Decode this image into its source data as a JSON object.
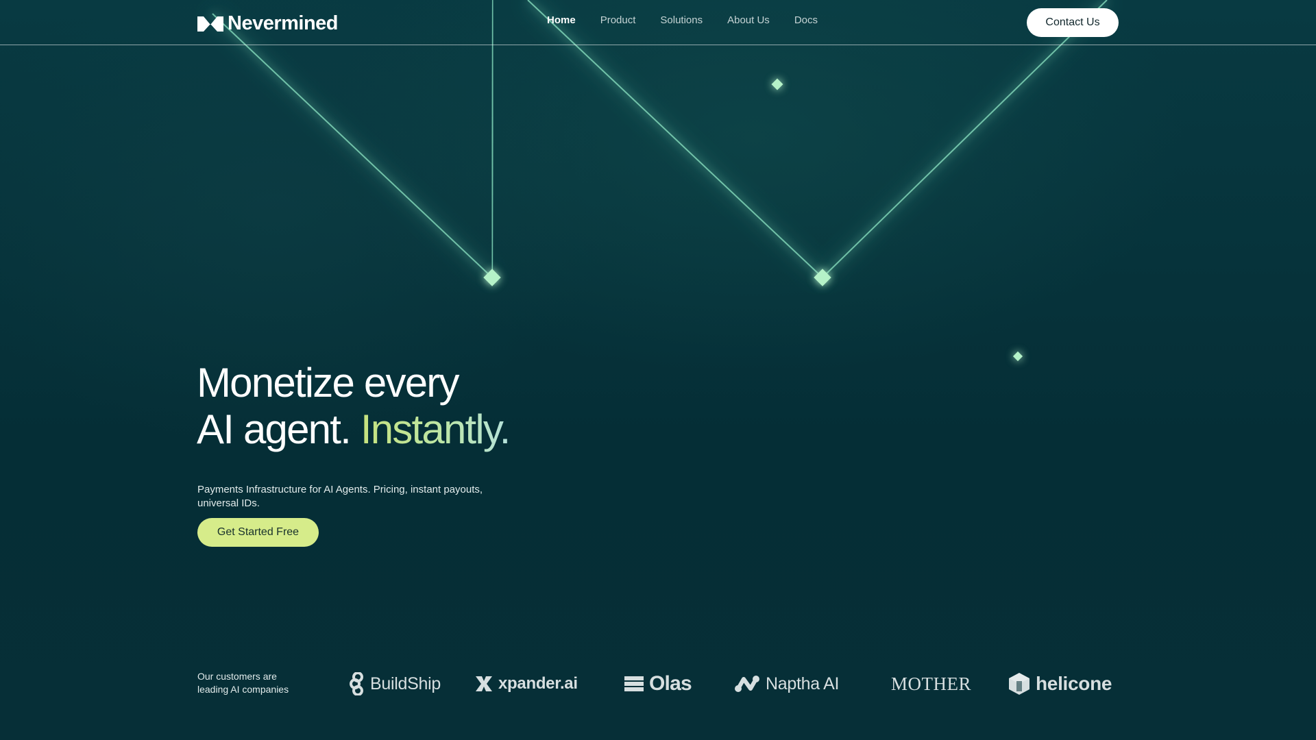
{
  "brand": {
    "name": "Nevermined",
    "logo_icon": "nevermined-mark-icon"
  },
  "nav": {
    "items": [
      {
        "label": "Home",
        "active": true
      },
      {
        "label": "Product",
        "active": false
      },
      {
        "label": "Solutions",
        "active": false
      },
      {
        "label": "About Us",
        "active": false
      },
      {
        "label": "Docs",
        "active": false
      }
    ],
    "contact_label": "Contact Us"
  },
  "hero": {
    "title_line1": "Monetize every",
    "title_line2": "AI agent.",
    "title_accent": "Instantly.",
    "subtitle": "Payments Infrastructure for AI Agents. Pricing, instant payouts, universal IDs.",
    "cta_label": "Get Started Free"
  },
  "customers": {
    "label": "Our customers are leading AI companies",
    "logos": [
      {
        "name": "BuildShip",
        "icon": "buildship-icon"
      },
      {
        "name": "xpander.ai",
        "icon": "xpander-icon"
      },
      {
        "name": "Olas",
        "icon": "olas-icon"
      },
      {
        "name": "Naptha AI",
        "icon": "naptha-icon"
      },
      {
        "name": "MOTHER",
        "icon": ""
      },
      {
        "name": "helicone",
        "icon": "helicone-icon"
      }
    ]
  },
  "colors": {
    "background": "#062f37",
    "accent_lime": "#d6ec8a",
    "glow_line": "#7fe0b8",
    "text_primary": "#ffffff",
    "text_muted": "#c5d3d4"
  }
}
